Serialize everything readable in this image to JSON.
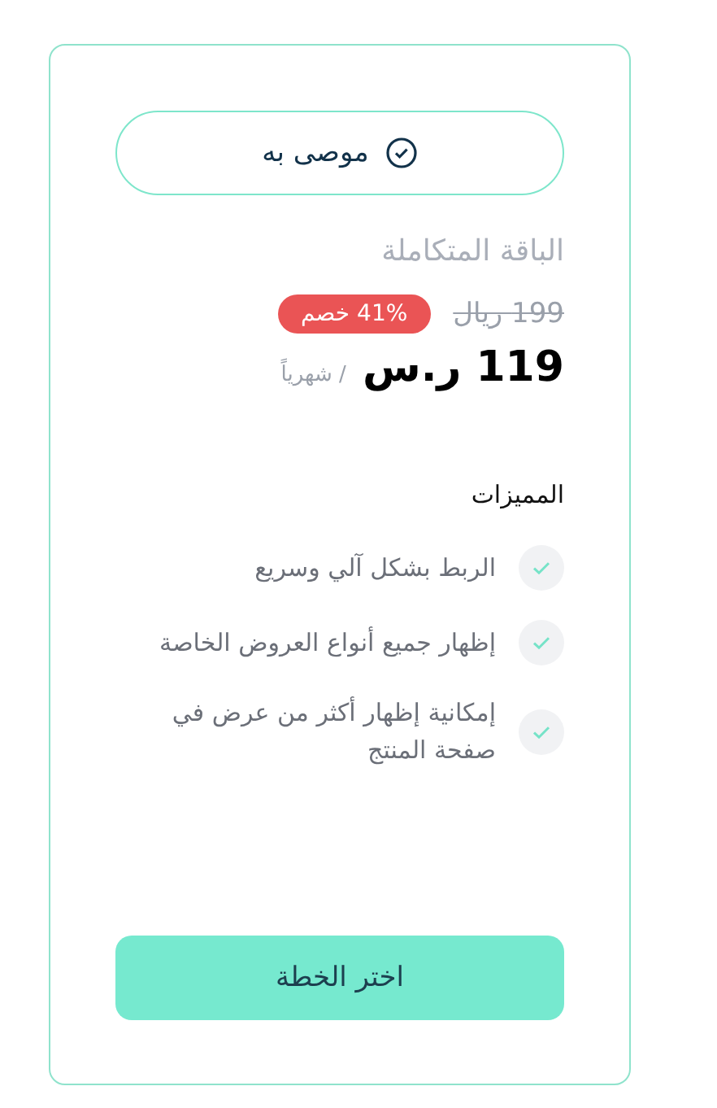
{
  "badge": {
    "label": "موصى به"
  },
  "plan": {
    "name": "الباقة المتكاملة",
    "old_price": "199 ريال",
    "discount": "41% خصم",
    "price": "119 ر.س",
    "period": "/ شهرياً"
  },
  "features": {
    "title": "المميزات",
    "items": [
      {
        "label": "الربط بشكل آلي وسريع",
        "checked": true
      },
      {
        "label": "إظهار جميع أنواع العروض الخاصة",
        "checked": true
      },
      {
        "label": "إمكانية إظهار أكثر من عرض في صفحة المنتج",
        "checked": true
      }
    ]
  },
  "button": {
    "label": "اختر الخطة"
  }
}
